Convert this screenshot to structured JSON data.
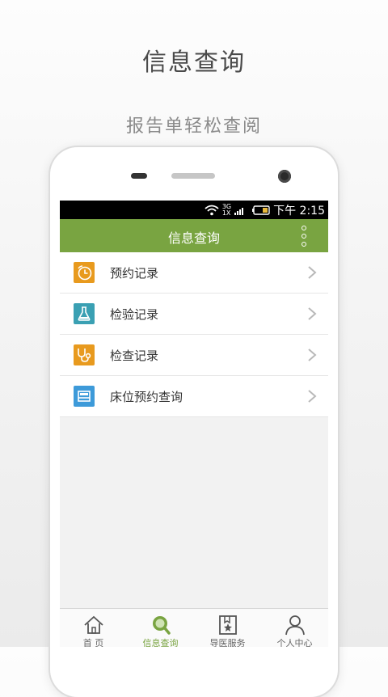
{
  "promo": {
    "title": "信息查询",
    "subtitle": "报告单轻松查阅"
  },
  "status_bar": {
    "network_top": "3G",
    "network_bottom": "1X",
    "time": "下午 2:15"
  },
  "app_bar": {
    "title": "信息查询",
    "more_icon": "more-vertical-icon"
  },
  "menu": {
    "items": [
      {
        "label": "预约记录",
        "icon": "clock-icon",
        "color": "#e89a1e"
      },
      {
        "label": "检验记录",
        "icon": "flask-icon",
        "color": "#3aa0b3"
      },
      {
        "label": "检查记录",
        "icon": "stethoscope-icon",
        "color": "#e89a1e"
      },
      {
        "label": "床位预约查询",
        "icon": "bed-icon",
        "color": "#3d9ad9"
      }
    ]
  },
  "tabs": [
    {
      "label": "首 页",
      "icon": "home-icon",
      "active": false
    },
    {
      "label": "信息查询",
      "icon": "search-icon",
      "active": true
    },
    {
      "label": "导医服务",
      "icon": "bookmark-star-icon",
      "active": false
    },
    {
      "label": "个人中心",
      "icon": "user-icon",
      "active": false
    }
  ],
  "colors": {
    "accent": "#79a441",
    "status_bar": "#000000"
  }
}
